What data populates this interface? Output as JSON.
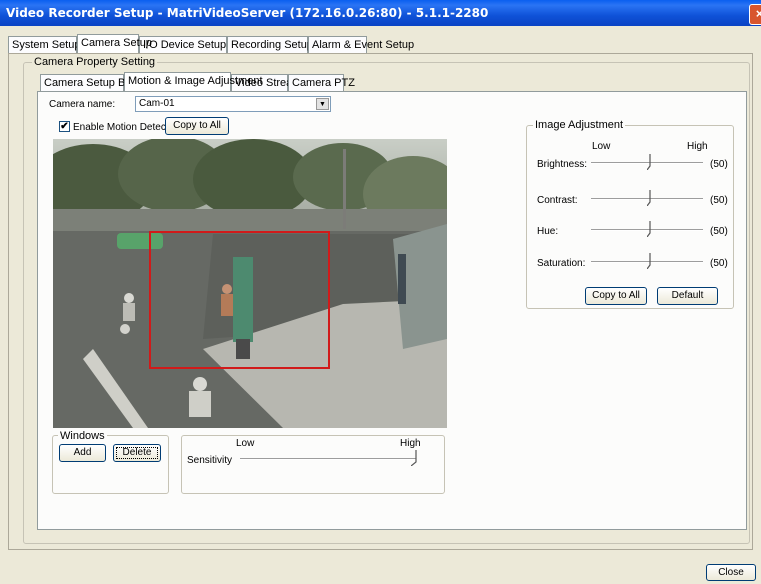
{
  "window": {
    "title": "Video Recorder Setup - MatriVideoServer (172.16.0.26:80) - 5.1.1-2280",
    "close_glyph": "×"
  },
  "main_tabs": [
    "System Setup",
    "Camera Setup",
    "I/O Device Setup",
    "Recording Setup",
    "Alarm & Event Setup"
  ],
  "camera_property": {
    "legend": "Camera Property Setting",
    "sub_tabs": [
      "Camera Setup Basic",
      "Motion & Image Adjustment",
      "Video Stream",
      "Camera PTZ"
    ]
  },
  "camera": {
    "name_label": "Camera name:",
    "name_value": "Cam-01",
    "dropdown_glyph": "▼"
  },
  "motion": {
    "enable_label": "Enable Motion Detection",
    "enabled": true,
    "check_glyph": "✔",
    "copy_label": "Copy to All"
  },
  "windows": {
    "legend": "Windows",
    "add_label": "Add",
    "delete_label": "Delete"
  },
  "sensitivity": {
    "low_label": "Low",
    "high_label": "High",
    "label": "Sensitivity",
    "level": 1.0
  },
  "image_adjustment": {
    "legend": "Image Adjustment",
    "low_label": "Low",
    "high_label": "High",
    "sliders": [
      {
        "label": "Brightness:",
        "value_text": "(50)",
        "value": 50
      },
      {
        "label": "Contrast:",
        "value_text": "(50)",
        "value": 50
      },
      {
        "label": "Hue:",
        "value_text": "(50)",
        "value": 50
      },
      {
        "label": "Saturation:",
        "value_text": "(50)",
        "value": 50
      }
    ],
    "copy_label": "Copy to All",
    "default_label": "Default"
  },
  "footer": {
    "close_label": "Close"
  },
  "colors": {
    "title_bar": "#0a5ff0",
    "motion_window": "#d11a1a",
    "dialog_bg": "#ece9d8"
  }
}
